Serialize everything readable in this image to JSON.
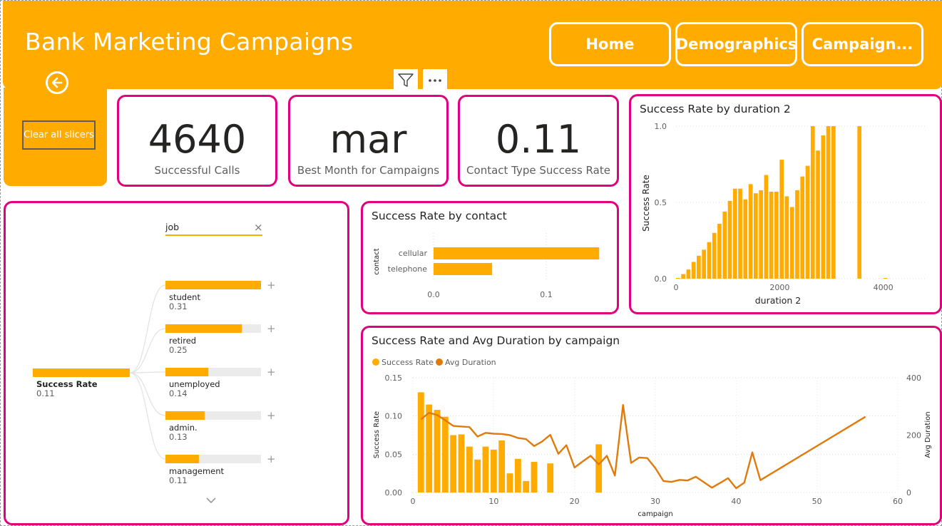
{
  "header": {
    "title": "Bank Marketing Campaigns",
    "nav": [
      {
        "label": "Home"
      },
      {
        "label": "Demographics"
      },
      {
        "label": "Campaign..."
      }
    ],
    "clear_slicers": "Clear all slicers"
  },
  "kpis": [
    {
      "value": "4640",
      "label": "Successful Calls"
    },
    {
      "value": "mar",
      "label": "Best Month for Campaigns"
    },
    {
      "value": "0.11",
      "label": "Contact Type Success Rate"
    }
  ],
  "decomp_tree": {
    "field": "job",
    "root": {
      "label": "Success Rate",
      "value": "0.11",
      "fraction": 1.0
    },
    "items": [
      {
        "label": "student",
        "value": "0.31",
        "fraction": 1.0
      },
      {
        "label": "retired",
        "value": "0.25",
        "fraction": 0.8
      },
      {
        "label": "unemployed",
        "value": "0.14",
        "fraction": 0.45
      },
      {
        "label": "admin.",
        "value": "0.13",
        "fraction": 0.41
      },
      {
        "label": "management",
        "value": "0.11",
        "fraction": 0.35
      }
    ],
    "expand_symbol": "+",
    "close_symbol": "×"
  },
  "colors": {
    "accent": "#FFAB00",
    "card_border": "#E3007D",
    "line": "#E07B0B"
  },
  "chart_data": [
    {
      "id": "contact",
      "type": "bar",
      "orientation": "horizontal",
      "title": "Success Rate by contact",
      "ylabel": "contact",
      "categories": [
        "cellular",
        "telephone"
      ],
      "values": [
        0.147,
        0.052
      ],
      "xlim": [
        0,
        0.15
      ],
      "xticks": [
        0.0,
        0.1
      ],
      "xtick_labels": [
        "0.0",
        "0.1"
      ]
    },
    {
      "id": "duration",
      "type": "bar",
      "title": "Success Rate by duration 2",
      "xlabel": "duration 2",
      "ylabel": "Success Rate",
      "xlim": [
        0,
        4500
      ],
      "ylim": [
        0,
        1
      ],
      "xticks": [
        0,
        2000,
        4000
      ],
      "xtick_labels": [
        "0",
        "2000",
        "4000"
      ],
      "yticks": [
        0,
        0.5,
        1.0
      ],
      "ytick_labels": [
        "0.0",
        "0.5",
        "1.0"
      ],
      "bin_width": 100,
      "x": [
        0,
        100,
        200,
        300,
        400,
        500,
        600,
        700,
        800,
        900,
        1000,
        1100,
        1200,
        1300,
        1400,
        1500,
        1600,
        1700,
        1800,
        1900,
        2000,
        2100,
        2200,
        2300,
        2400,
        2500,
        2600,
        2700,
        2800,
        2900,
        3000,
        3500,
        4000
      ],
      "values": [
        0.0,
        0.03,
        0.06,
        0.11,
        0.15,
        0.19,
        0.24,
        0.3,
        0.36,
        0.44,
        0.51,
        0.59,
        0.59,
        0.52,
        0.62,
        0.56,
        0.58,
        0.68,
        0.57,
        0.57,
        0.78,
        0.54,
        0.47,
        0.58,
        0.67,
        0.74,
        1.0,
        0.84,
        0.94,
        1.0,
        1.0,
        1.0,
        0.0
      ]
    },
    {
      "id": "campaign",
      "type": "combo",
      "title": "Success Rate and Avg Duration by campaign",
      "xlabel": "campaign",
      "ylabel": "Success Rate",
      "y2label": "Avg Duration",
      "legend": [
        "Success Rate",
        "Avg Duration"
      ],
      "xlim": [
        0,
        60
      ],
      "ylim": [
        0,
        0.15
      ],
      "y2lim": [
        0,
        400
      ],
      "xticks": [
        0,
        10,
        20,
        30,
        40,
        50,
        60
      ],
      "yticks": [
        0,
        0.05,
        0.1,
        0.15
      ],
      "ytick_labels": [
        "0.00",
        "0.05",
        "0.10",
        "0.15"
      ],
      "y2ticks": [
        0,
        200,
        400
      ],
      "bars": {
        "name": "Success Rate",
        "x": [
          1,
          2,
          3,
          4,
          5,
          6,
          7,
          8,
          9,
          10,
          11,
          12,
          13,
          14,
          15,
          16,
          17,
          23
        ],
        "values": [
          0.131,
          0.115,
          0.108,
          0.099,
          0.075,
          0.076,
          0.06,
          0.043,
          0.06,
          0.056,
          0.068,
          0.025,
          0.044,
          0.015,
          0.04,
          0.0,
          0.038,
          0.063
        ]
      },
      "line": {
        "name": "Avg Duration",
        "x": [
          1,
          2,
          3,
          4,
          5,
          6,
          7,
          8,
          9,
          10,
          11,
          12,
          13,
          14,
          15,
          16,
          17,
          18,
          19,
          20,
          21,
          22,
          23,
          24,
          25,
          26,
          27,
          28,
          29,
          30,
          31,
          32,
          33,
          34,
          35,
          36,
          37,
          38,
          39,
          40,
          41,
          42,
          43,
          56
        ],
        "values": [
          255,
          278,
          270,
          252,
          232,
          230,
          228,
          195,
          208,
          205,
          204,
          200,
          190,
          186,
          162,
          178,
          201,
          135,
          165,
          87,
          108,
          128,
          98,
          128,
          59,
          305,
          103,
          122,
          120,
          85,
          40,
          37,
          44,
          42,
          55,
          36,
          17,
          33,
          50,
          15,
          34,
          140,
          43,
          264
        ]
      }
    }
  ]
}
